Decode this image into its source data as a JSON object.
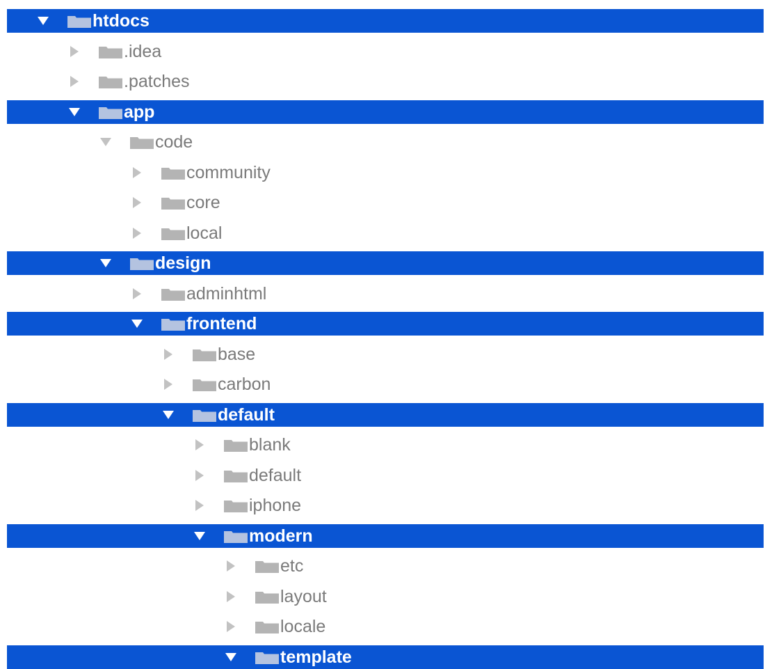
{
  "colors": {
    "selection": "#0a55d3",
    "folder": "#b4b4b4",
    "folder_selected": "#b4c3e0",
    "arrow": "#c2c2c2",
    "arrow_selected": "#ffffff",
    "text": "#7a7a7a",
    "text_selected": "#ffffff"
  },
  "tree": [
    {
      "label": "htdocs",
      "level": 0,
      "expanded": true,
      "selected": true,
      "icon": "folder-icon"
    },
    {
      "label": ".idea",
      "level": 1,
      "expanded": false,
      "selected": false,
      "icon": "folder-icon"
    },
    {
      "label": ".patches",
      "level": 1,
      "expanded": false,
      "selected": false,
      "icon": "folder-icon"
    },
    {
      "label": "app",
      "level": 1,
      "expanded": true,
      "selected": true,
      "icon": "folder-icon"
    },
    {
      "label": "code",
      "level": 2,
      "expanded": true,
      "selected": false,
      "icon": "folder-icon"
    },
    {
      "label": "community",
      "level": 3,
      "expanded": false,
      "selected": false,
      "icon": "folder-icon"
    },
    {
      "label": "core",
      "level": 3,
      "expanded": false,
      "selected": false,
      "icon": "folder-icon"
    },
    {
      "label": "local",
      "level": 3,
      "expanded": false,
      "selected": false,
      "icon": "folder-icon"
    },
    {
      "label": "design",
      "level": 2,
      "expanded": true,
      "selected": true,
      "icon": "folder-icon"
    },
    {
      "label": "adminhtml",
      "level": 3,
      "expanded": false,
      "selected": false,
      "icon": "folder-icon"
    },
    {
      "label": "frontend",
      "level": 3,
      "expanded": true,
      "selected": true,
      "icon": "folder-icon"
    },
    {
      "label": "base",
      "level": 4,
      "expanded": false,
      "selected": false,
      "icon": "folder-icon"
    },
    {
      "label": "carbon",
      "level": 4,
      "expanded": false,
      "selected": false,
      "icon": "folder-icon"
    },
    {
      "label": "default",
      "level": 4,
      "expanded": true,
      "selected": true,
      "icon": "folder-icon"
    },
    {
      "label": "blank",
      "level": 5,
      "expanded": false,
      "selected": false,
      "icon": "folder-icon"
    },
    {
      "label": "default",
      "level": 5,
      "expanded": false,
      "selected": false,
      "icon": "folder-icon"
    },
    {
      "label": "iphone",
      "level": 5,
      "expanded": false,
      "selected": false,
      "icon": "folder-icon"
    },
    {
      "label": "modern",
      "level": 5,
      "expanded": true,
      "selected": true,
      "icon": "folder-icon"
    },
    {
      "label": "etc",
      "level": 6,
      "expanded": false,
      "selected": false,
      "icon": "folder-icon"
    },
    {
      "label": "layout",
      "level": 6,
      "expanded": false,
      "selected": false,
      "icon": "folder-icon"
    },
    {
      "label": "locale",
      "level": 6,
      "expanded": false,
      "selected": false,
      "icon": "folder-icon"
    },
    {
      "label": "template",
      "level": 6,
      "expanded": true,
      "selected": true,
      "icon": "folder-icon"
    }
  ]
}
